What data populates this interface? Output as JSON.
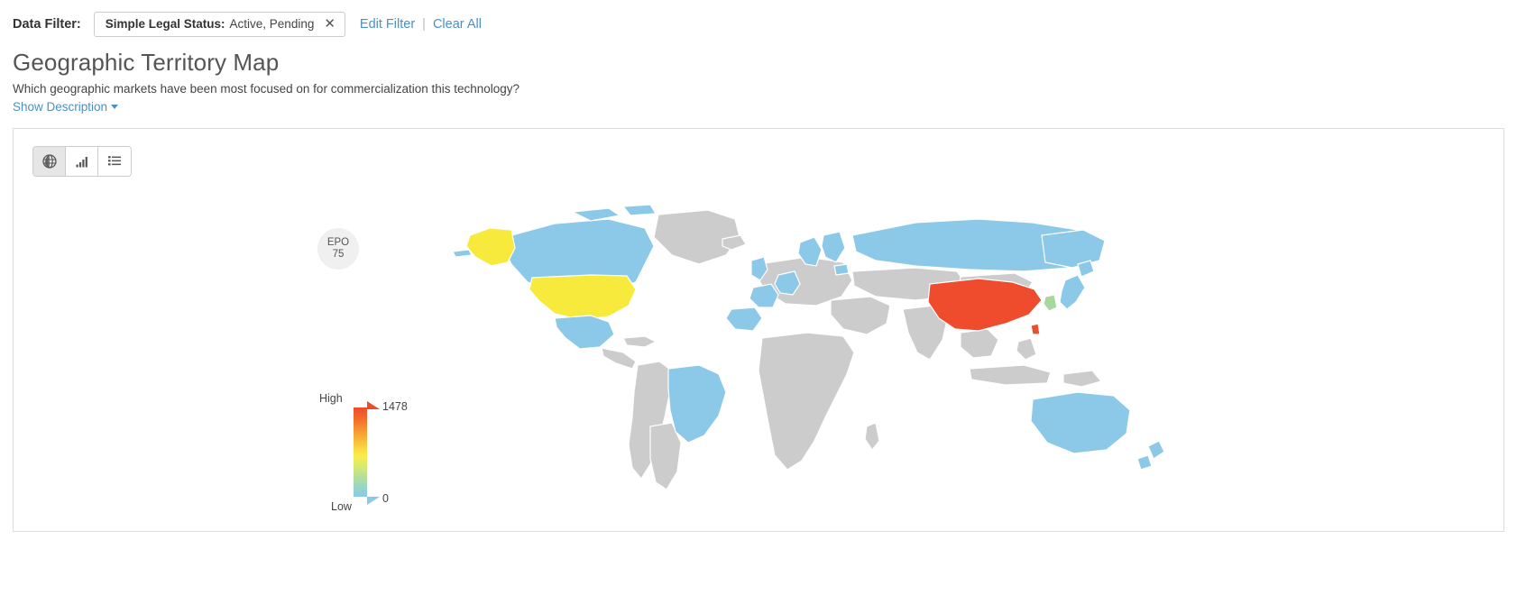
{
  "filter_bar": {
    "label": "Data Filter:",
    "chip": {
      "key": "Simple Legal Status:",
      "value": "Active, Pending",
      "close_icon": "✕"
    },
    "edit_filter": "Edit Filter",
    "separator": "|",
    "clear_all": "Clear All"
  },
  "header": {
    "title": "Geographic Territory Map",
    "subtitle": "Which geographic markets have been most focused on for commercialization this technology?",
    "show_description": "Show Description"
  },
  "view_toggle": {
    "buttons": [
      {
        "name": "globe-icon",
        "label": "Map view",
        "active": true
      },
      {
        "name": "bar-chart-icon",
        "label": "Chart view",
        "active": false
      },
      {
        "name": "list-icon",
        "label": "List view",
        "active": false
      }
    ]
  },
  "map_marker": {
    "label": "EPO",
    "value": "75"
  },
  "legend": {
    "high_label": "High",
    "low_label": "Low",
    "max_value": "1478",
    "min_value": "0",
    "gradient_top_color": "#ee4c2c",
    "gradient_bottom_color": "#8cc9e8"
  },
  "chart_data": {
    "type": "heatmap",
    "title": "Geographic Territory Map",
    "subtitle": "Which geographic markets have been most focused on for commercialization this technology?",
    "scale_min": 0,
    "scale_max": 1478,
    "colorscale": [
      "#8cc9e8",
      "#95d6c4",
      "#aedea0",
      "#d9e870",
      "#f6ee4f",
      "#fadb3f",
      "#f79b33",
      "#f26a28",
      "#ee4c2c"
    ],
    "no_data_color": "#cccccc",
    "regions": [
      {
        "name": "China",
        "color": "#ee4c2c",
        "level": "very high"
      },
      {
        "name": "United States",
        "color": "#f8ea3c",
        "level": "high"
      },
      {
        "name": "Russia",
        "color": "#8cc9e8",
        "level": "low"
      },
      {
        "name": "Canada",
        "color": "#8cc9e8",
        "level": "low"
      },
      {
        "name": "Mexico",
        "color": "#8cc9e8",
        "level": "low"
      },
      {
        "name": "Brazil",
        "color": "#8cc9e8",
        "level": "low"
      },
      {
        "name": "Australia",
        "color": "#8cc9e8",
        "level": "low"
      },
      {
        "name": "Japan",
        "color": "#8cc9e8",
        "level": "low"
      },
      {
        "name": "South Korea",
        "color": "#a8d8a0",
        "level": "low-mid"
      },
      {
        "name": "United Kingdom",
        "color": "#8cc9e8",
        "level": "low"
      },
      {
        "name": "France",
        "color": "#8cc9e8",
        "level": "low"
      },
      {
        "name": "Germany",
        "color": "#8cc9e8",
        "level": "low"
      },
      {
        "name": "Spain",
        "color": "#8cc9e8",
        "level": "low"
      },
      {
        "name": "Sweden",
        "color": "#8cc9e8",
        "level": "low"
      },
      {
        "name": "Finland",
        "color": "#8cc9e8",
        "level": "low"
      },
      {
        "name": "Greenland",
        "color": "#cccccc",
        "level": "no data"
      }
    ],
    "markers": [
      {
        "label": "EPO",
        "value": 75
      }
    ]
  }
}
